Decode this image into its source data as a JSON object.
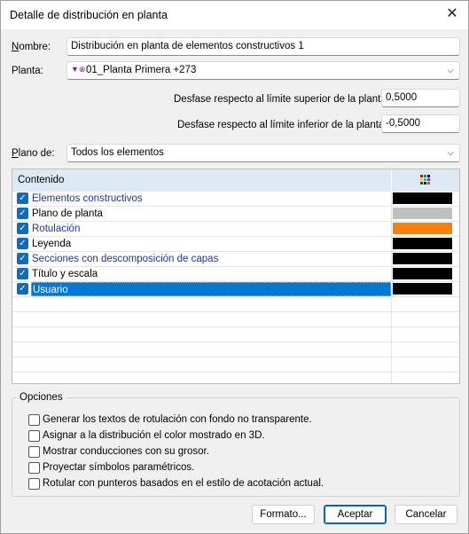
{
  "window": {
    "title": "Detalle de distribución en planta",
    "close_glyph": "✕"
  },
  "nombre": {
    "label_first": "N",
    "label_rest": "ombre:",
    "value": "Distribución en planta de elementos constructivos 1"
  },
  "planta": {
    "label": "Planta:",
    "value": "01_Planta Primera +273"
  },
  "desfase_sup": {
    "label": "Desfase respecto al límite superior de la planta:",
    "value": "0,5000"
  },
  "desfase_inf": {
    "label": "Desfase respecto al límite inferior de la planta:",
    "value": "-0,5000"
  },
  "plano": {
    "label_first": "P",
    "label_rest": "lano de:",
    "value": "Todos los elementos"
  },
  "table": {
    "header_content": "Contenido",
    "rows": [
      {
        "label": "Elementos constructivos",
        "checked": true,
        "color": "#000000",
        "blue": true
      },
      {
        "label": "Plano de planta",
        "checked": true,
        "color": "#c0c0c0",
        "blue": false
      },
      {
        "label": "Rotulación",
        "checked": true,
        "color": "#ff8000",
        "blue": true
      },
      {
        "label": "Leyenda",
        "checked": true,
        "color": "#000000",
        "blue": false
      },
      {
        "label": "Secciones con descomposición de capas",
        "checked": true,
        "color": "#000000",
        "blue": true
      },
      {
        "label": "Título y escala",
        "checked": true,
        "color": "#000000",
        "blue": false
      },
      {
        "label": "Usuario",
        "checked": true,
        "color": "#000000",
        "blue": false,
        "selected": true
      }
    ]
  },
  "options": {
    "title": "Opciones",
    "items": [
      {
        "label": "Generar los textos de rotulación con fondo no transparente.",
        "checked": false
      },
      {
        "label": "Asignar a la distribución el color mostrado en 3D.",
        "checked": false
      },
      {
        "label": "Mostrar conducciones con su grosor.",
        "checked": false
      },
      {
        "label": "Proyectar símbolos paramétricos.",
        "checked": false
      },
      {
        "label": "Rotular con punteros basados en el estilo de acotación actual.",
        "checked": false
      }
    ]
  },
  "buttons": {
    "formato": "Formato...",
    "aceptar": "Aceptar",
    "cancelar": "Cancelar"
  },
  "colors": {
    "accent": "#0078d4",
    "link_blue": "#1c31b8",
    "header_bg": "#dde9f5"
  }
}
